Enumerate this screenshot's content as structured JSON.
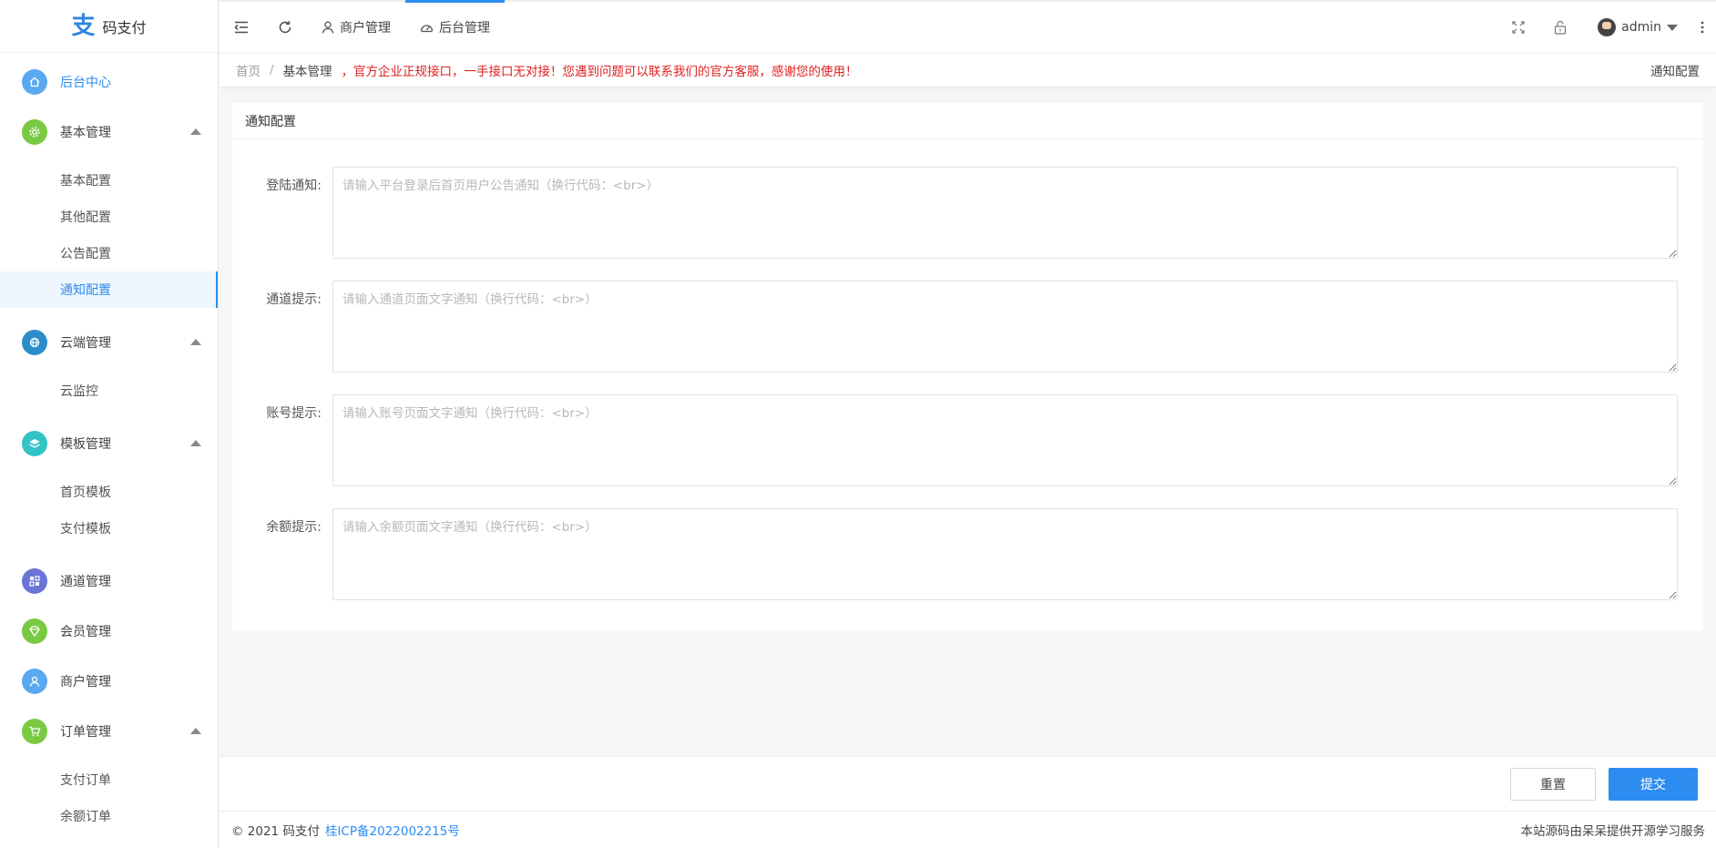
{
  "app": {
    "logo_mark": "支",
    "title": "码支付"
  },
  "sidebar": {
    "items": [
      {
        "label": "后台中心",
        "icon": "home-icon",
        "color": "#5aa9f0",
        "active": true,
        "expandable": false,
        "children": []
      },
      {
        "label": "基本管理",
        "icon": "gear-icon",
        "color": "#7ac943",
        "active": false,
        "expandable": true,
        "children": [
          {
            "label": "基本配置",
            "active": false
          },
          {
            "label": "其他配置",
            "active": false
          },
          {
            "label": "公告配置",
            "active": false
          },
          {
            "label": "通知配置",
            "active": true
          }
        ]
      },
      {
        "label": "云端管理",
        "icon": "cloud-icon",
        "color": "#2b8ec9",
        "active": false,
        "expandable": true,
        "children": [
          {
            "label": "云监控",
            "active": false
          }
        ]
      },
      {
        "label": "模板管理",
        "icon": "layers-icon",
        "color": "#33c3c5",
        "active": false,
        "expandable": true,
        "children": [
          {
            "label": "首页模板",
            "active": false
          },
          {
            "label": "支付模板",
            "active": false
          }
        ]
      },
      {
        "label": "通道管理",
        "icon": "channel-icon",
        "color": "#6b74d6",
        "active": false,
        "expandable": false,
        "children": []
      },
      {
        "label": "会员管理",
        "icon": "diamond-icon",
        "color": "#7ac943",
        "active": false,
        "expandable": false,
        "children": []
      },
      {
        "label": "商户管理",
        "icon": "user-icon",
        "color": "#5aa9f0",
        "active": false,
        "expandable": false,
        "children": []
      },
      {
        "label": "订单管理",
        "icon": "cart-icon",
        "color": "#7ac943",
        "active": false,
        "expandable": true,
        "children": [
          {
            "label": "支付订单",
            "active": false
          },
          {
            "label": "余额订单",
            "active": false
          }
        ]
      }
    ]
  },
  "header": {
    "merchant_label": "商户管理",
    "admin_label": "后台管理",
    "user_name": "admin"
  },
  "breadcrumb": {
    "home": "首页",
    "section": "基本管理",
    "notice": "，官方企业正规接口，一手接口无对接！您遇到问题可以联系我们的官方客服，感谢您的使用！",
    "current": "通知配置"
  },
  "card": {
    "title": "通知配置"
  },
  "form": {
    "fields": [
      {
        "label": "登陆通知:",
        "value": "",
        "placeholder": "请输入平台登录后首页用户公告通知（换行代码：<br>）"
      },
      {
        "label": "通道提示:",
        "value": "",
        "placeholder": "请输入通道页面文字通知（换行代码：<br>）"
      },
      {
        "label": "账号提示:",
        "value": "",
        "placeholder": "请输入账号页面文字通知（换行代码：<br>）"
      },
      {
        "label": "余额提示:",
        "value": "",
        "placeholder": "请输入余额页面文字通知（换行代码：<br>）"
      }
    ]
  },
  "actions": {
    "reset": "重置",
    "submit": "提交"
  },
  "footer": {
    "copyright": "© 2021 码支付",
    "icp": "桂ICP备2022002215号",
    "right": "本站源码由呆呆提供开源学习服务"
  },
  "colors": {
    "accent": "#2d8cf0",
    "notice": "#e02020"
  }
}
